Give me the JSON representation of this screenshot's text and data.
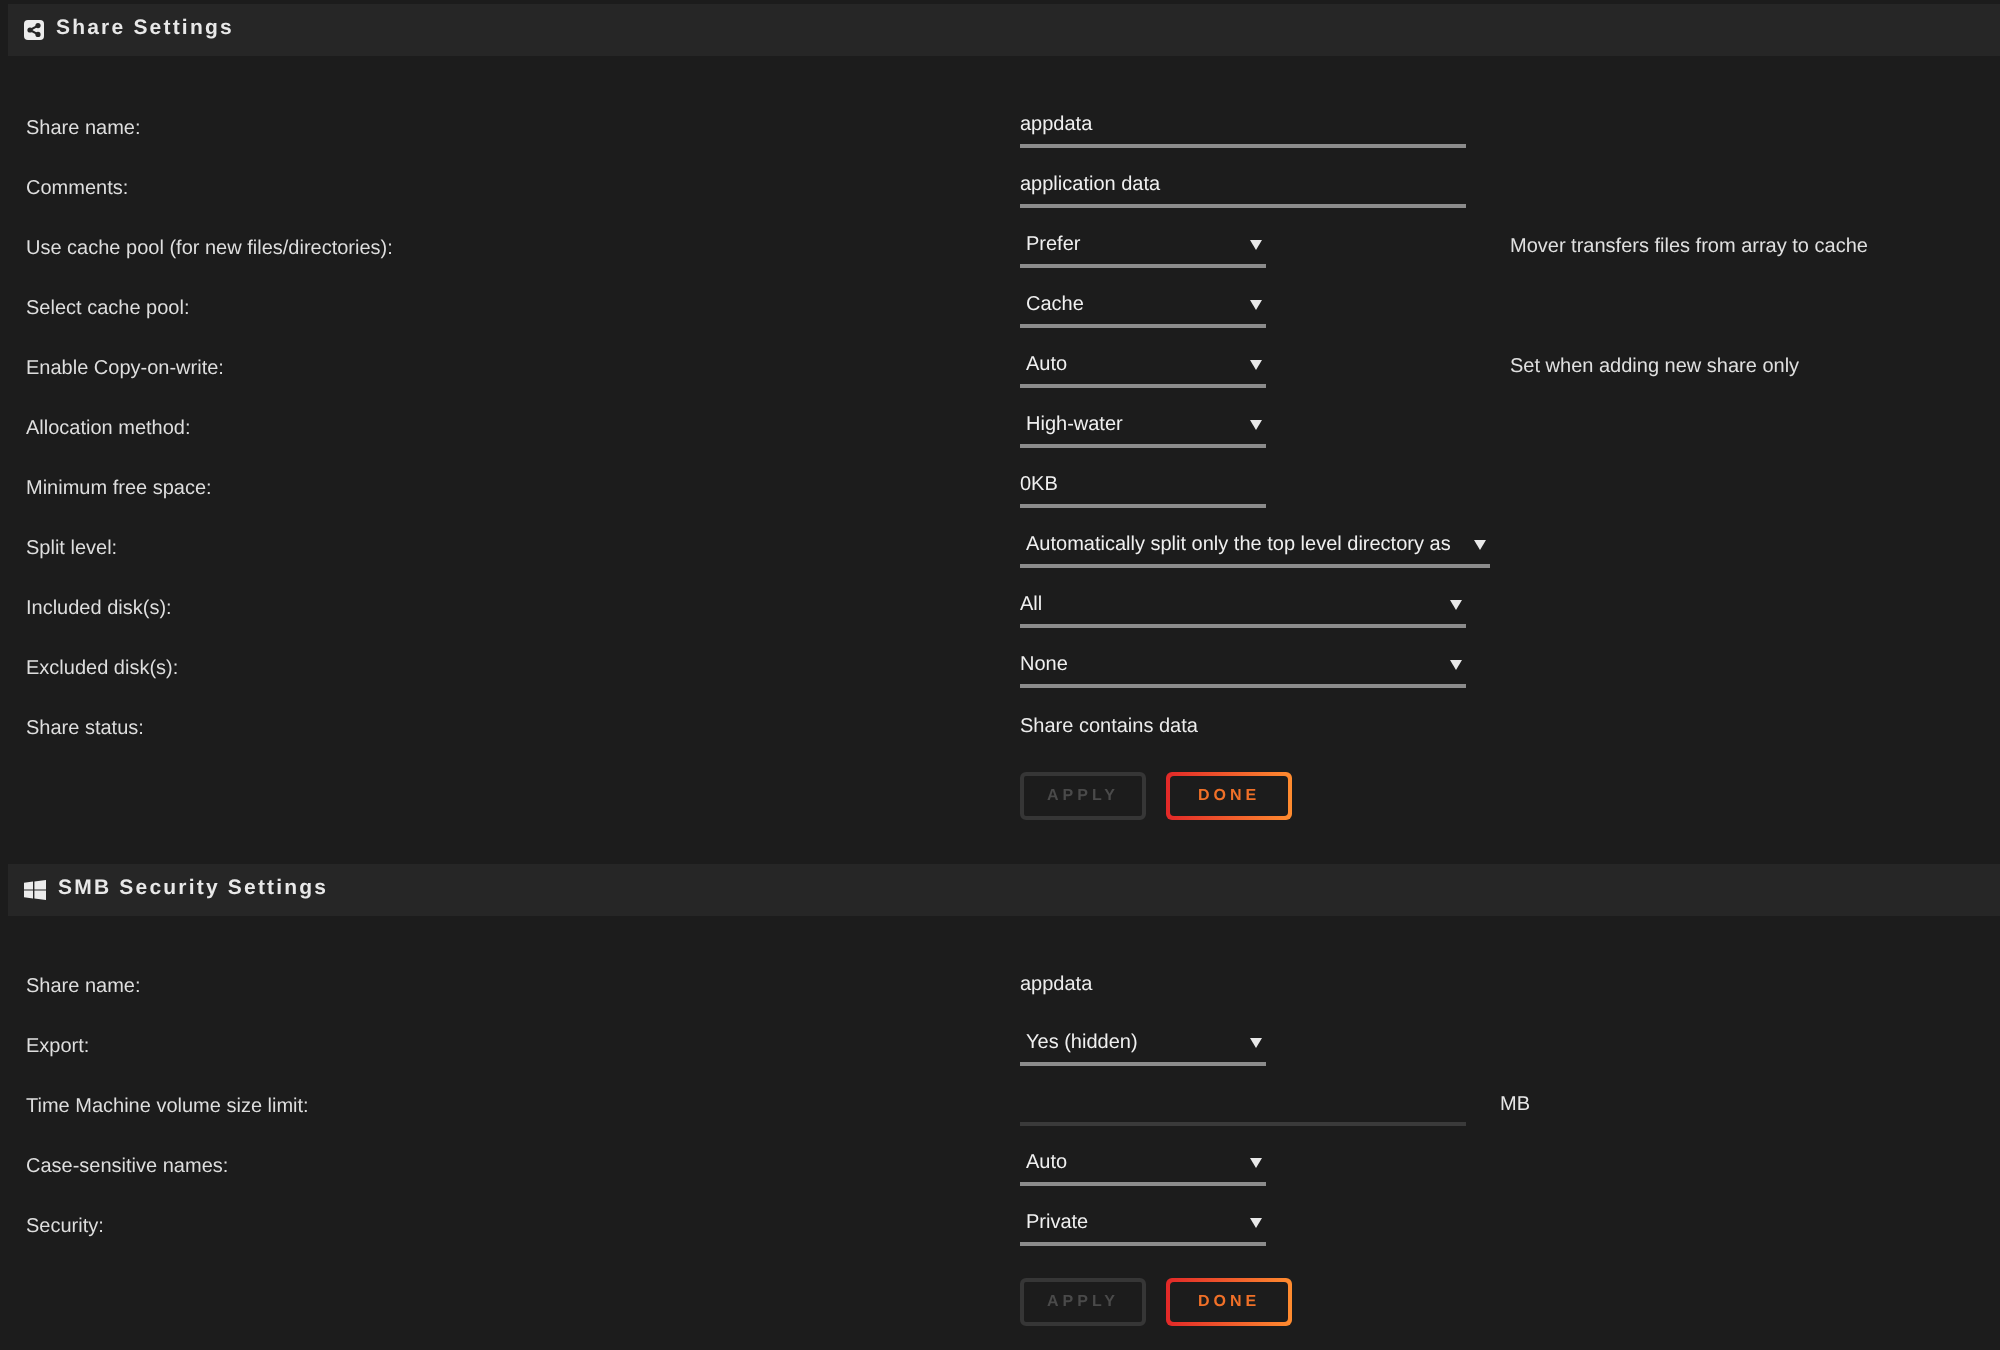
{
  "sections": [
    {
      "kind": "share",
      "title": "Share Settings",
      "fields": [
        {
          "label": "Share name:",
          "kind": "text",
          "value": "appdata"
        },
        {
          "label": "Comments:",
          "kind": "text",
          "value": "application data"
        },
        {
          "label": "Use cache pool (for new files/directories):",
          "kind": "select",
          "value": "Prefer",
          "note": "Mover transfers files from array to cache"
        },
        {
          "label": "Select cache pool:",
          "kind": "select",
          "value": "Cache"
        },
        {
          "label": "Enable Copy-on-write:",
          "kind": "select",
          "value": "Auto",
          "note": "Set when adding new share only"
        },
        {
          "label": "Allocation method:",
          "kind": "select",
          "value": "High-water"
        },
        {
          "label": "Minimum free space:",
          "kind": "short-text",
          "value": "0KB"
        },
        {
          "label": "Split level:",
          "kind": "wide-select",
          "value": "Automatically split only the top level directory as"
        },
        {
          "label": "Included disk(s):",
          "kind": "multi-select",
          "value": "All"
        },
        {
          "label": "Excluded disk(s):",
          "kind": "multi-select",
          "value": "None"
        },
        {
          "label": "Share status:",
          "kind": "static",
          "value": "Share contains data"
        }
      ],
      "buttons": [
        {
          "label": "APPLY",
          "disabled": true
        },
        {
          "label": "DONE",
          "disabled": false
        }
      ]
    },
    {
      "kind": "smb",
      "title": "SMB Security Settings",
      "fields": [
        {
          "label": "Share name:",
          "kind": "static",
          "value": "appdata"
        },
        {
          "label": "Export:",
          "kind": "select",
          "value": "Yes (hidden)"
        },
        {
          "label": "Time Machine volume size limit:",
          "kind": "text",
          "unit": "MB"
        },
        {
          "label": "Case-sensitive names:",
          "kind": "select",
          "value": "Auto"
        },
        {
          "label": "Security:",
          "kind": "select",
          "value": "Private"
        }
      ],
      "buttons": [
        {
          "label": "APPLY",
          "disabled": true
        },
        {
          "label": "DONE",
          "disabled": false
        }
      ]
    }
  ]
}
